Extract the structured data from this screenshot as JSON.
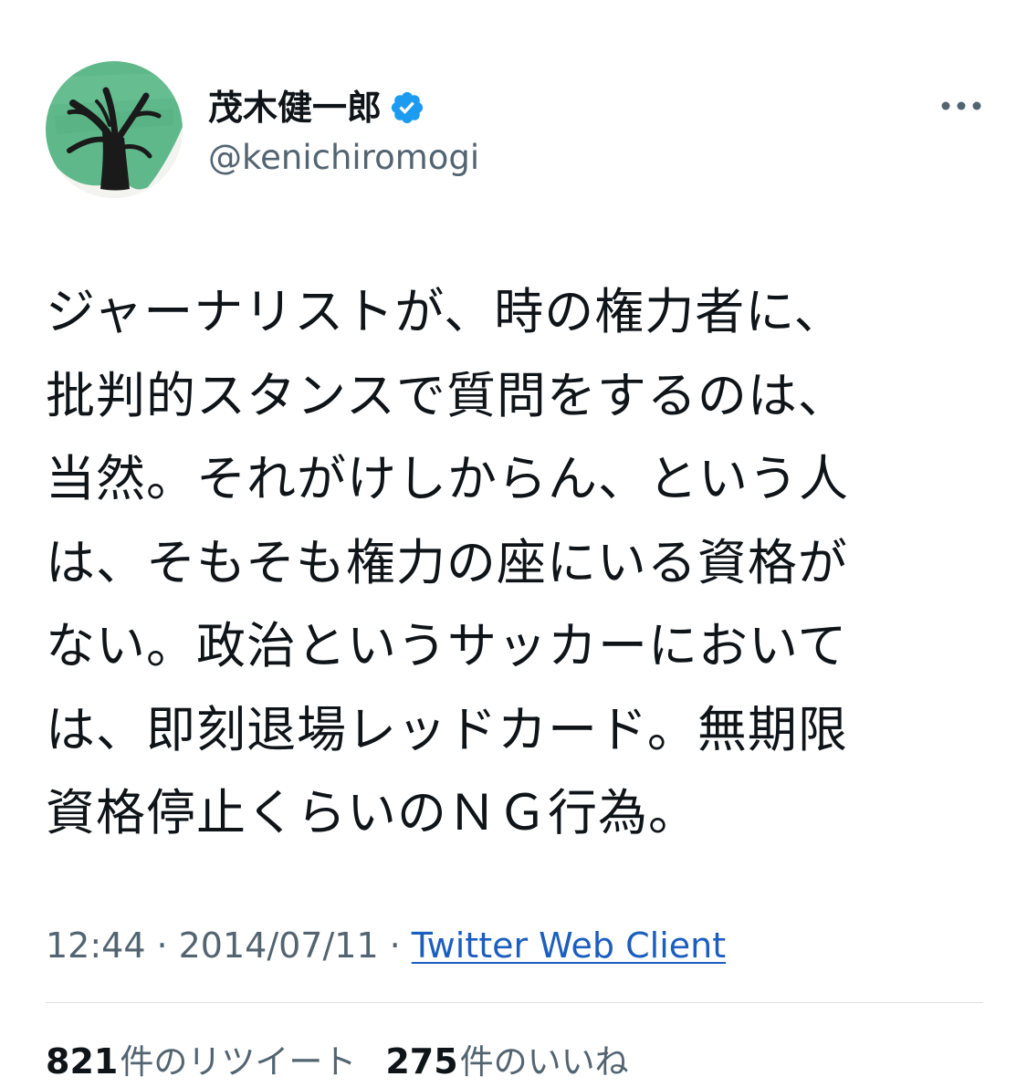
{
  "user": {
    "display_name": "茂木健一郎",
    "handle": "@kenichiromogi",
    "verified": true,
    "avatar_icon": "tree-drawing-avatar"
  },
  "menu": {
    "more_icon": "more-horizontal-icon"
  },
  "tweet": {
    "text": "ジャーナリストが、時の権力者に、\n批判的スタンスで質問をするのは、\n当然。それがけしからん、という人\nは、そもそも権力の座にいる資格が\nない。政治というサッカーにおいて\nは、即刻退場レッドカード。無期限\n資格停止くらいのＮＧ行為。",
    "time": "12:44",
    "separator": "·",
    "date": "2014/07/11",
    "client": "Twitter Web Client"
  },
  "stats": {
    "retweets_count": "821",
    "retweets_label": "件のリツイート",
    "likes_count": "275",
    "likes_label": "件のいいね"
  },
  "colors": {
    "verified": "#1d9bf0",
    "secondary_text": "#536471",
    "link": "#1b5ebf"
  }
}
